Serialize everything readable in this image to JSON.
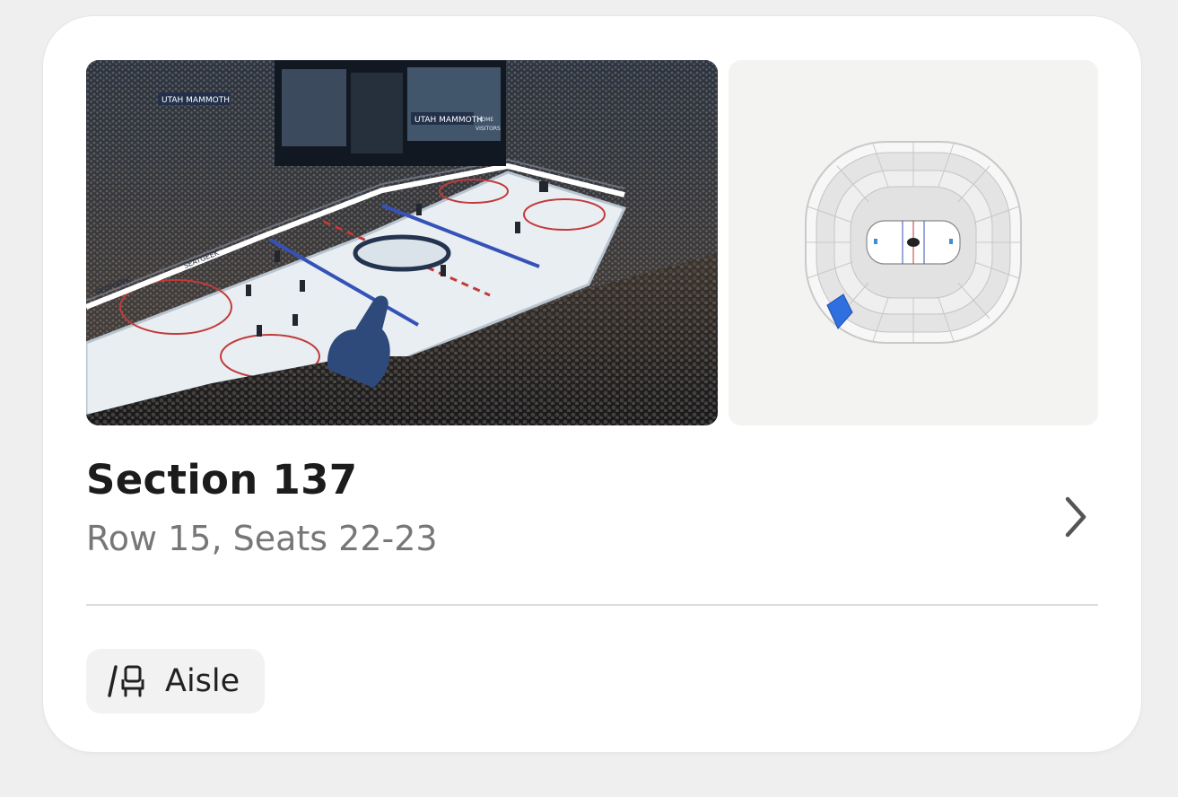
{
  "listing": {
    "section": "Section 137",
    "row_seats": "Row 15, Seats 22-23",
    "feature": {
      "label": "Aisle",
      "icon": "aisle-seat-icon"
    }
  },
  "photo": {
    "board_brand": "UTAH MAMMOTH",
    "sponsor": "SEATGEEK",
    "scoreboard_home": "HOME",
    "scoreboard_visitors": "VISITORS"
  },
  "colors": {
    "highlight_section": "#2f6fe0",
    "card_bg": "#ffffff",
    "page_bg": "#efefef"
  }
}
